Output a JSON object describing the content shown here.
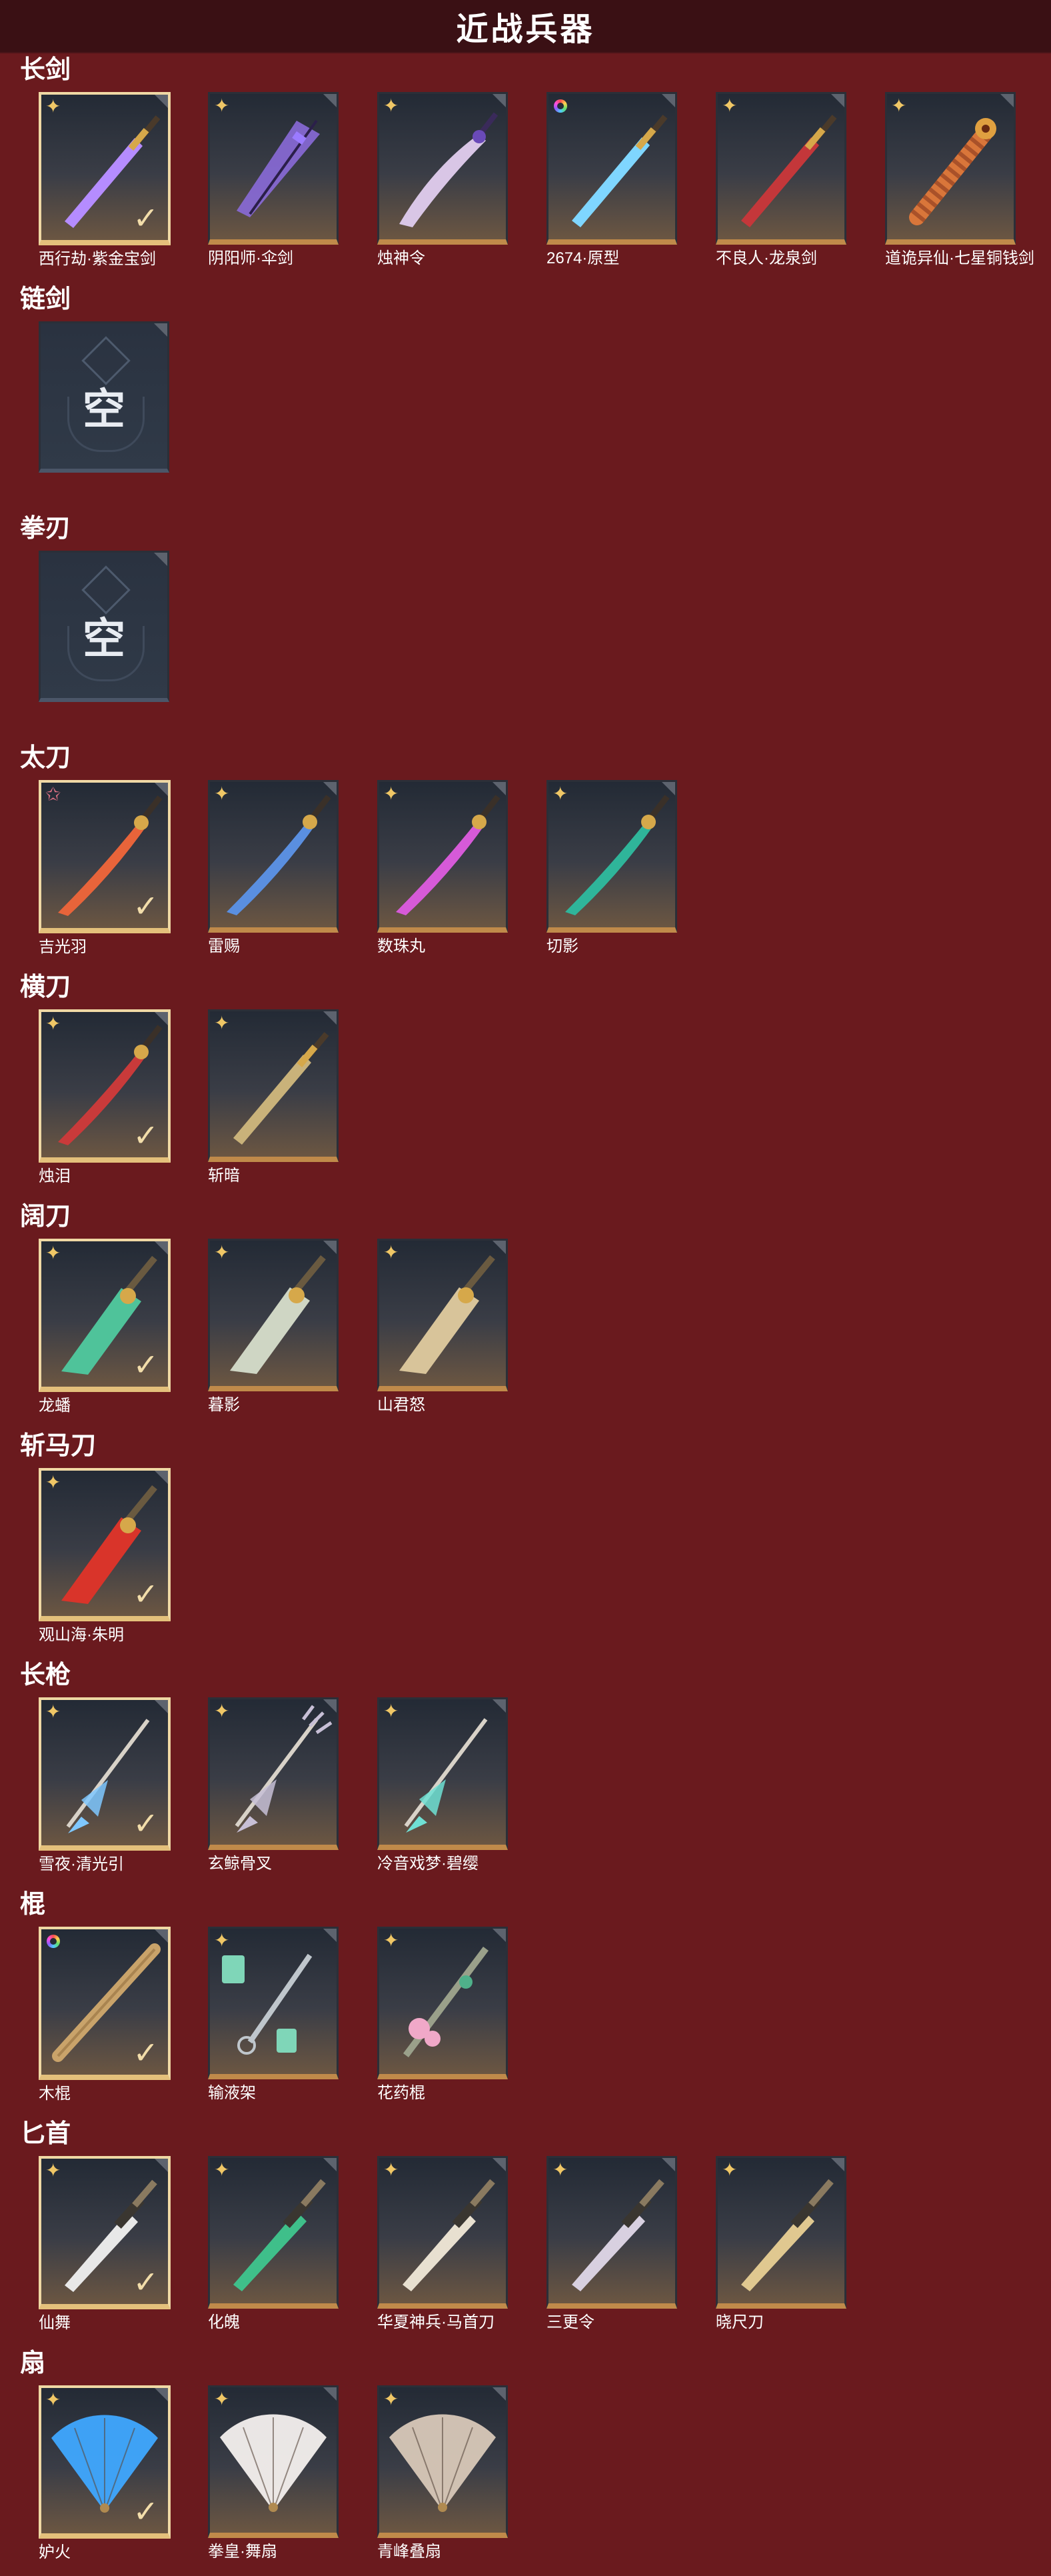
{
  "title": "近战兵器",
  "colors": {
    "background": "#6a1a1e",
    "header": "#3a1014",
    "card_border_gold": "#c08a4a",
    "equipped_border": "#efd8a4"
  },
  "categories": [
    {
      "name": "长剑",
      "items": [
        {
          "label": "西行劫·紫金宝剑",
          "equipped": true,
          "rarity": "gold-star-icon",
          "weapon": "sword",
          "color": "#b58cff"
        },
        {
          "label": "阴阳师·伞剑",
          "equipped": false,
          "rarity": "gold-star-icon",
          "weapon": "umbrella",
          "color": "#8a6ad8"
        },
        {
          "label": "烛神令",
          "equipped": false,
          "rarity": "gold-star-icon",
          "weapon": "curved",
          "color": "#d9c6e6"
        },
        {
          "label": "2674·原型",
          "equipped": false,
          "rarity": "rainbow-ring-icon",
          "weapon": "sword",
          "color": "#7fd6ff"
        },
        {
          "label": "不良人·龙泉剑",
          "equipped": false,
          "rarity": "gold-star-icon",
          "weapon": "sword",
          "color": "#c4373a"
        },
        {
          "label": "道诡异仙·七星铜钱剑",
          "equipped": false,
          "rarity": "gold-star-icon",
          "weapon": "coins",
          "color": "#d9763a"
        }
      ]
    },
    {
      "name": "链剑",
      "items": [
        {
          "label": "",
          "empty": true,
          "empty_text": "空"
        }
      ]
    },
    {
      "name": "拳刃",
      "items": [
        {
          "label": "",
          "empty": true,
          "empty_text": "空"
        }
      ]
    },
    {
      "name": "太刀",
      "items": [
        {
          "label": "吉光羽",
          "equipped": true,
          "rarity": "pink-star-icon",
          "weapon": "blade",
          "color": "#e8643a"
        },
        {
          "label": "雷赐",
          "equipped": false,
          "rarity": "gold-star-icon",
          "weapon": "blade",
          "color": "#5a8fe0"
        },
        {
          "label": "数珠丸",
          "equipped": false,
          "rarity": "gold-star-icon",
          "weapon": "blade",
          "color": "#d65ad8"
        },
        {
          "label": "切影",
          "equipped": false,
          "rarity": "gold-star-icon",
          "weapon": "blade",
          "color": "#2fb59a"
        }
      ]
    },
    {
      "name": "横刀",
      "items": [
        {
          "label": "烛泪",
          "equipped": true,
          "rarity": "gold-star-icon",
          "weapon": "blade",
          "color": "#c93a3a"
        },
        {
          "label": "斩暗",
          "equipped": false,
          "rarity": "gold-star-icon",
          "weapon": "sword",
          "color": "#c9b27a"
        }
      ]
    },
    {
      "name": "阔刀",
      "items": [
        {
          "label": "龙蟠",
          "equipped": true,
          "rarity": "gold-star-icon",
          "weapon": "broad",
          "color": "#4fc39a"
        },
        {
          "label": "暮影",
          "equipped": false,
          "rarity": "gold-star-icon",
          "weapon": "broad",
          "color": "#cfd6c4"
        },
        {
          "label": "山君怒",
          "equipped": false,
          "rarity": "gold-star-icon",
          "weapon": "broad",
          "color": "#d8c49a"
        }
      ]
    },
    {
      "name": "斩马刀",
      "items": [
        {
          "label": "观山海·朱明",
          "equipped": true,
          "rarity": "gold-star-icon",
          "weapon": "broad",
          "color": "#d9342a"
        }
      ]
    },
    {
      "name": "长枪",
      "items": [
        {
          "label": "雪夜·清光引",
          "equipped": true,
          "rarity": "gold-star-icon",
          "weapon": "spear",
          "color": "#7fc8ff"
        },
        {
          "label": "玄鲸骨叉",
          "equipped": false,
          "rarity": "gold-star-icon",
          "weapon": "trident",
          "color": "#c7bfd6"
        },
        {
          "label": "冷音戏梦·碧缨",
          "equipped": false,
          "rarity": "gold-star-icon",
          "weapon": "spear",
          "color": "#6fe0d4"
        }
      ]
    },
    {
      "name": "棍",
      "items": [
        {
          "label": "木棍",
          "equipped": true,
          "rarity": "rainbow-ring-icon",
          "weapon": "stick",
          "color": "#c9a36a"
        },
        {
          "label": "输液架",
          "equipped": false,
          "rarity": "gold-star-icon",
          "weapon": "iv",
          "color": "#7fd6b8"
        },
        {
          "label": "花药棍",
          "equipped": false,
          "rarity": "gold-star-icon",
          "weapon": "staff",
          "color": "#f0a8c8"
        }
      ]
    },
    {
      "name": "匕首",
      "items": [
        {
          "label": "仙舞",
          "equipped": true,
          "rarity": "gold-star-icon",
          "weapon": "dagger",
          "color": "#e8e8e8"
        },
        {
          "label": "化魄",
          "equipped": false,
          "rarity": "gold-star-icon",
          "weapon": "dagger",
          "color": "#3fbf8a"
        },
        {
          "label": "华夏神兵·马首刀",
          "equipped": false,
          "rarity": "gold-star-icon",
          "weapon": "dagger",
          "color": "#e8e0d0"
        },
        {
          "label": "三更令",
          "equipped": false,
          "rarity": "gold-star-icon",
          "weapon": "dagger",
          "color": "#d8d0e0"
        },
        {
          "label": "晓尺刀",
          "equipped": false,
          "rarity": "gold-star-icon",
          "weapon": "dagger",
          "color": "#e0c890"
        }
      ]
    },
    {
      "name": "扇",
      "items": [
        {
          "label": "妒火",
          "equipped": true,
          "rarity": "gold-star-icon",
          "weapon": "fan",
          "color": "#3fa8ff"
        },
        {
          "label": "拳皇·舞扇",
          "equipped": false,
          "rarity": "gold-star-icon",
          "weapon": "fan",
          "color": "#f4f0ee"
        },
        {
          "label": "青峰叠扇",
          "equipped": false,
          "rarity": "gold-star-icon",
          "weapon": "fan",
          "color": "#d8c8b8"
        }
      ]
    }
  ]
}
